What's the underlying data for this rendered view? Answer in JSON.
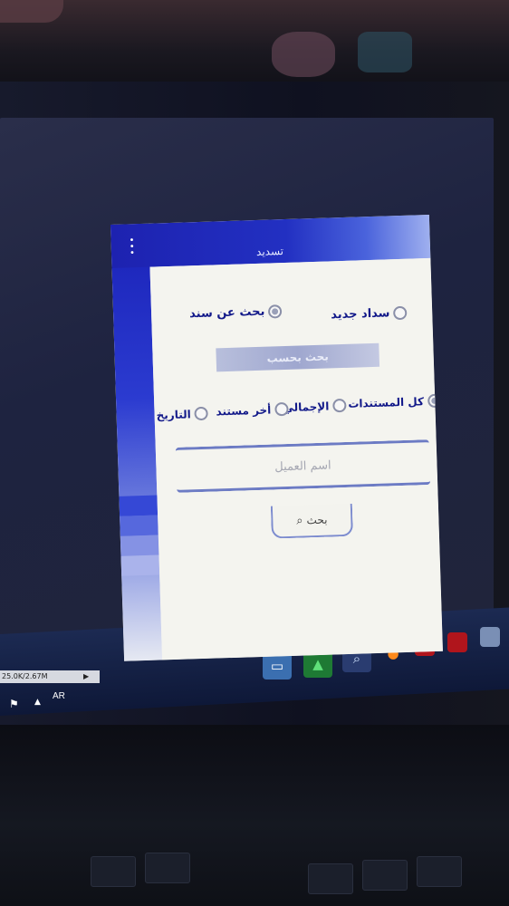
{
  "app": {
    "title": "تسديد",
    "menu_icon": "more-vertical-icon",
    "payment_type": {
      "options": [
        {
          "label": "سداد جديد",
          "checked": false
        },
        {
          "label": "بحث عن سند",
          "checked": true
        }
      ]
    },
    "search_by": {
      "header": "بحث بحسب",
      "options": [
        {
          "label": "كل المستندات",
          "checked": true
        },
        {
          "label": "الإجمالي",
          "checked": false
        },
        {
          "label": "أخر مستند",
          "checked": false
        },
        {
          "label": "التاريخ",
          "checked": false
        }
      ]
    },
    "customer_field": {
      "placeholder": "اسم العميل",
      "value": ""
    },
    "search_button": {
      "label": "بحث",
      "icon": "search-icon"
    }
  },
  "taskbar": {
    "status_text": "25.0K/2.67M",
    "language": "AR",
    "apps": [
      "file-explorer-icon",
      "green-triangle-icon",
      "magnifier-icon",
      "firefox-icon",
      "red-app-icon",
      "red-app-icon",
      "pdf-icon",
      "window-icon"
    ]
  }
}
